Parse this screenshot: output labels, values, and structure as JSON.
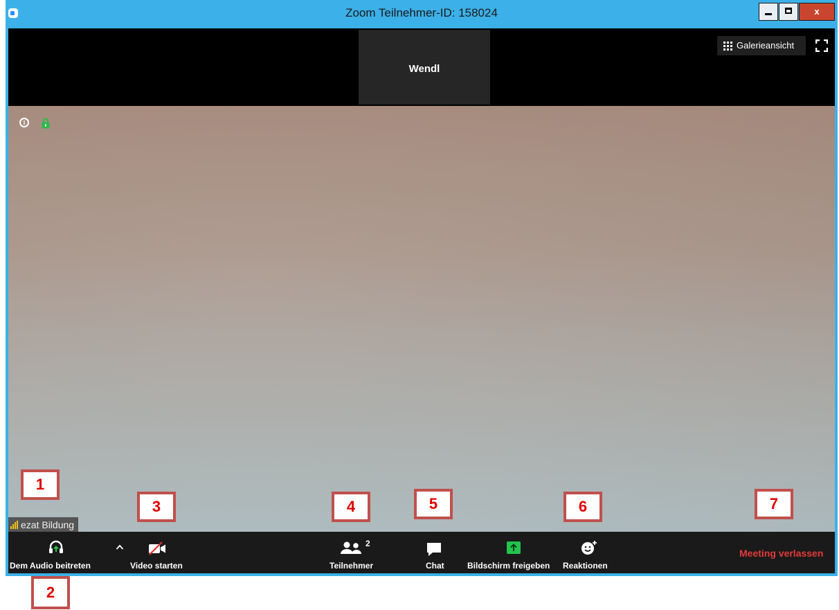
{
  "window": {
    "title": "Zoom Teilnehmer-ID: 158024",
    "close_label": "x"
  },
  "top": {
    "thumbnail_name": "Wendl",
    "gallery_label": "Galerieansicht"
  },
  "network": {
    "label": "ezat Bildung"
  },
  "toolbar": {
    "audio_label": "Dem Audio beitreten",
    "video_label": "Video starten",
    "participants_label": "Teilnehmer",
    "participants_count": "2",
    "chat_label": "Chat",
    "share_label": "Bildschirm freigeben",
    "reactions_label": "Reaktionen",
    "leave_label": "Meeting verlassen"
  },
  "markers": [
    "1",
    "2",
    "3",
    "4",
    "5",
    "6",
    "7"
  ],
  "colors": {
    "titlebar": "#3cb0e8",
    "toolbar": "#1a1a1a",
    "share_green": "#23c34d",
    "leave_red": "#e43a3a",
    "marker_border": "#c0504d",
    "marker_text": "#e00000"
  },
  "icons": [
    "headphones-icon",
    "chevron-up-icon",
    "video-off-icon",
    "participants-icon",
    "chat-icon",
    "share-screen-icon",
    "reactions-icon",
    "grid-icon",
    "fullscreen-icon",
    "info-icon",
    "lock-icon",
    "signal-bars-icon"
  ]
}
